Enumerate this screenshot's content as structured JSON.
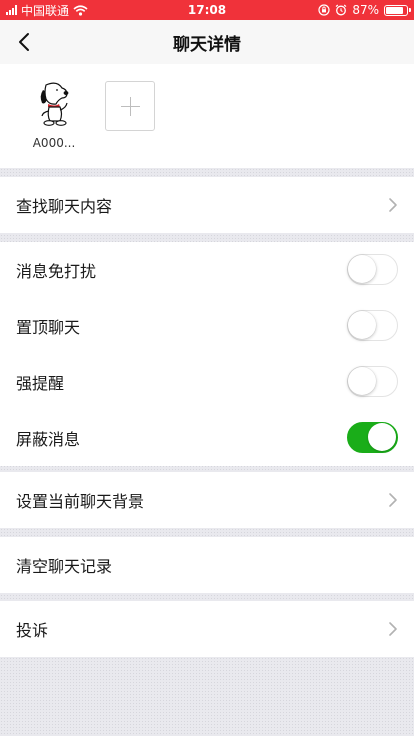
{
  "status_bar": {
    "carrier": "中国联通",
    "time": "17:08",
    "battery_text": "87%",
    "battery_level": 0.87,
    "background": "#f0323a"
  },
  "nav": {
    "title": "聊天详情",
    "back_icon": "chevron-left-icon"
  },
  "members": [
    {
      "name": "A000...",
      "avatar": "snoopy-avatar"
    }
  ],
  "add_member_icon": "plus-icon",
  "find_content": {
    "label": "查找聊天内容"
  },
  "toggles": [
    {
      "label": "消息免打扰",
      "on": false
    },
    {
      "label": "置顶聊天",
      "on": false
    },
    {
      "label": "强提醒",
      "on": false
    },
    {
      "label": "屏蔽消息",
      "on": true
    }
  ],
  "toggle_on_color": "#1aad19",
  "chat_background": {
    "label": "设置当前聊天背景"
  },
  "clear_history": {
    "label": "清空聊天记录"
  },
  "report": {
    "label": "投诉"
  }
}
